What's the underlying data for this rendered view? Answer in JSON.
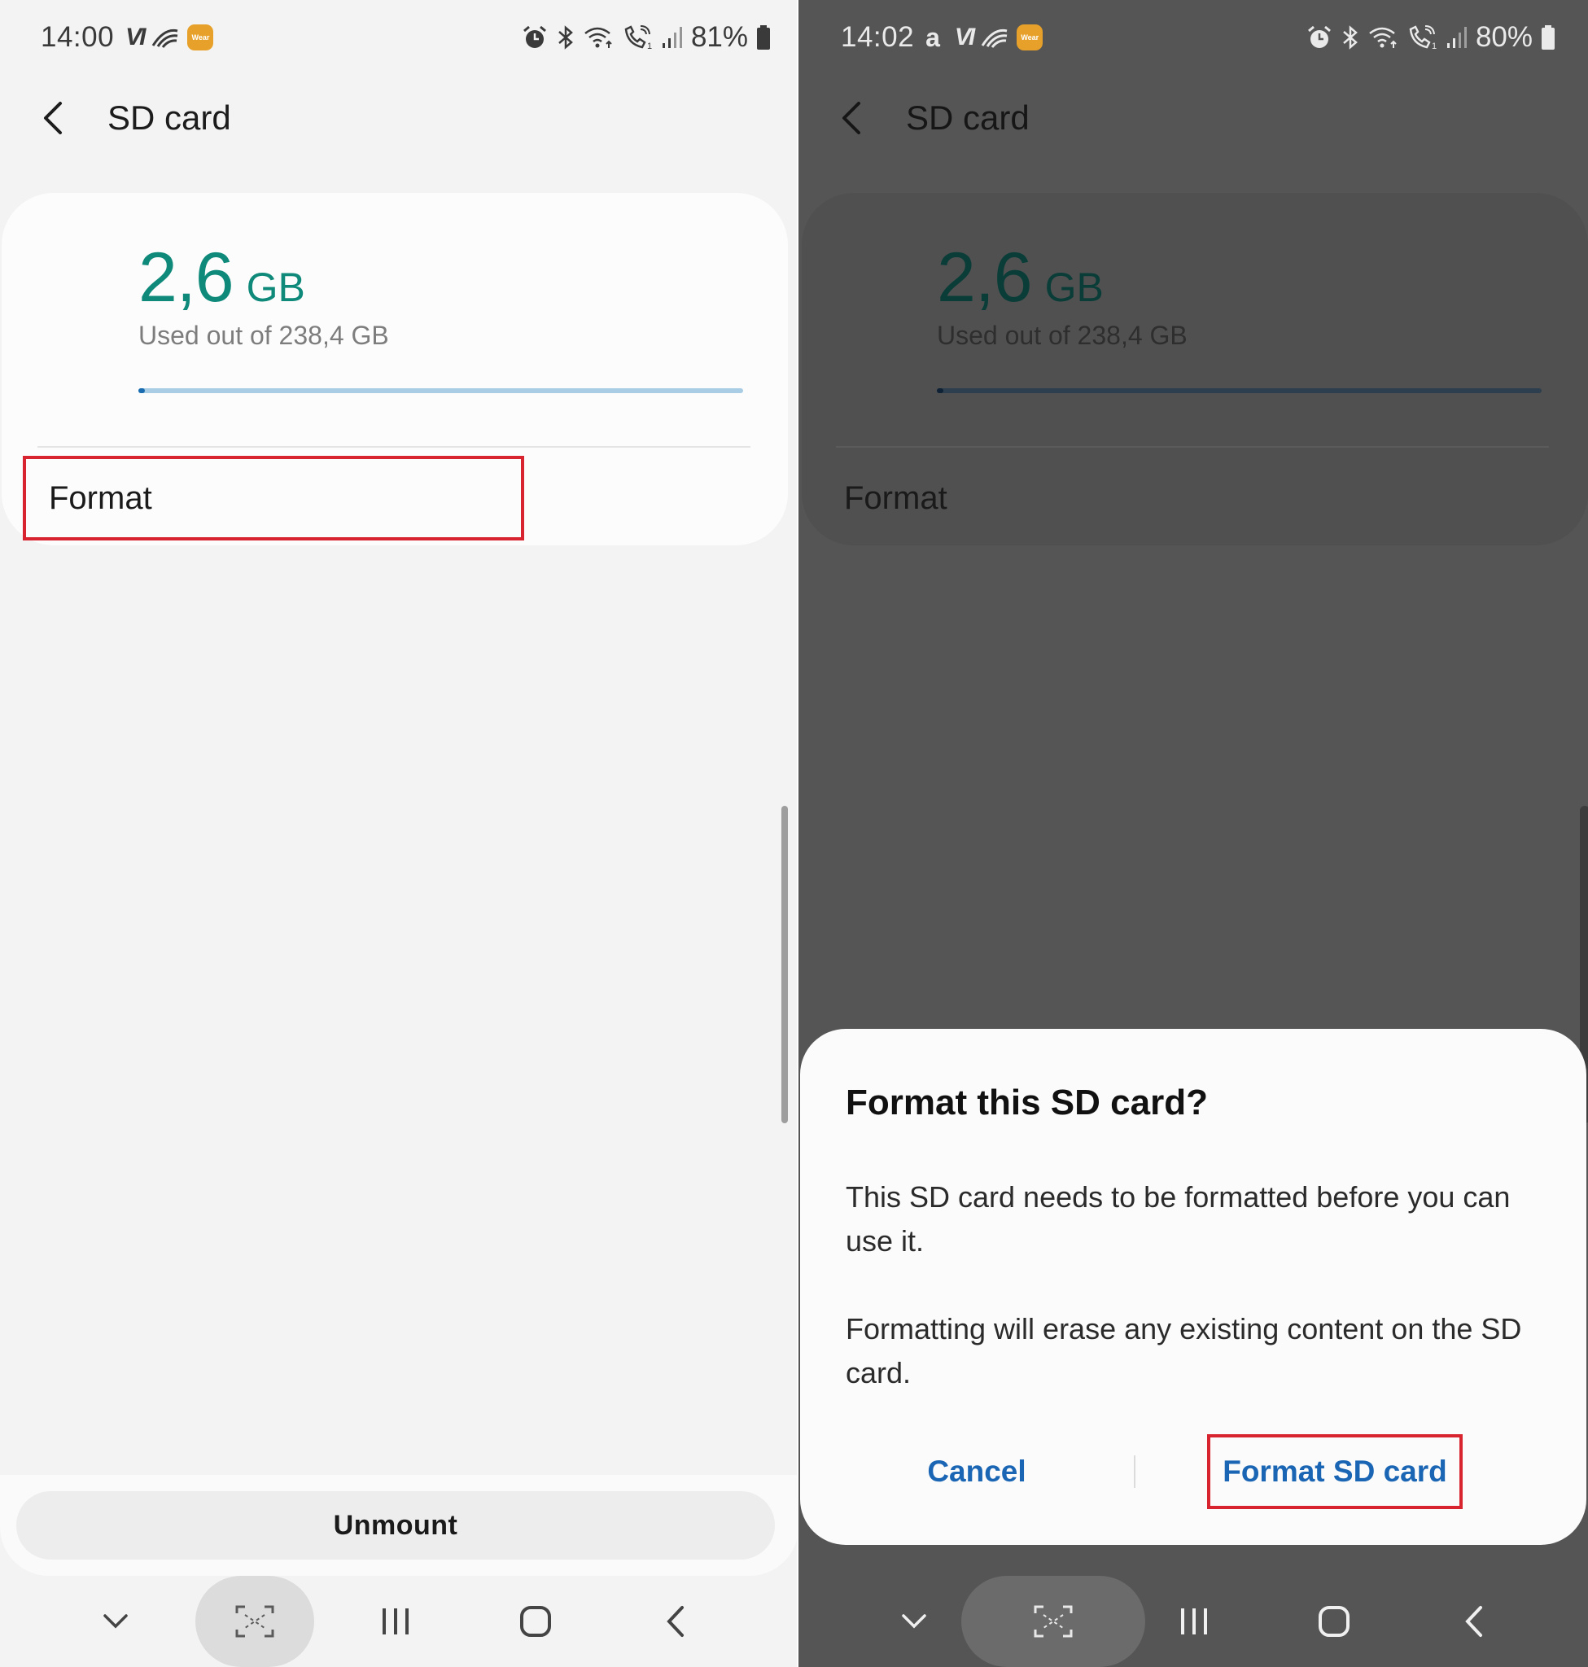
{
  "left": {
    "status": {
      "time": "14:00",
      "carrier": "VI",
      "wear_label": "Wear",
      "battery": "81%"
    },
    "title": "SD card",
    "storage": {
      "used": "2,6",
      "unit": "GB",
      "subtitle": "Used out of 238,4 GB",
      "used_fraction": 0.011
    },
    "format_label": "Format",
    "unmount_label": "Unmount"
  },
  "right": {
    "status": {
      "time": "14:02",
      "a_icon": "a",
      "carrier": "VI",
      "wear_label": "Wear",
      "battery": "80%"
    },
    "title": "SD card",
    "storage": {
      "used": "2,6",
      "unit": "GB",
      "subtitle": "Used out of 238,4 GB",
      "used_fraction": 0.011
    },
    "format_label": "Format",
    "dialog": {
      "title": "Format this SD card?",
      "body1": "This SD card needs to be formatted before you can use it.",
      "body2": "Formatting will erase any existing content on the SD card.",
      "cancel": "Cancel",
      "confirm": "Format SD card"
    }
  },
  "colors": {
    "accent_teal": "#0f8a7a",
    "highlight_red": "#d8242e",
    "button_blue": "#1a66b4"
  },
  "icons": [
    "back-chevron-icon",
    "alarm-icon",
    "bluetooth-icon",
    "wifi-icon",
    "call-icon",
    "signal-icon",
    "battery-icon",
    "nav-down-icon",
    "nav-screenshot-icon",
    "nav-recents-icon",
    "nav-home-icon",
    "nav-back-icon"
  ]
}
